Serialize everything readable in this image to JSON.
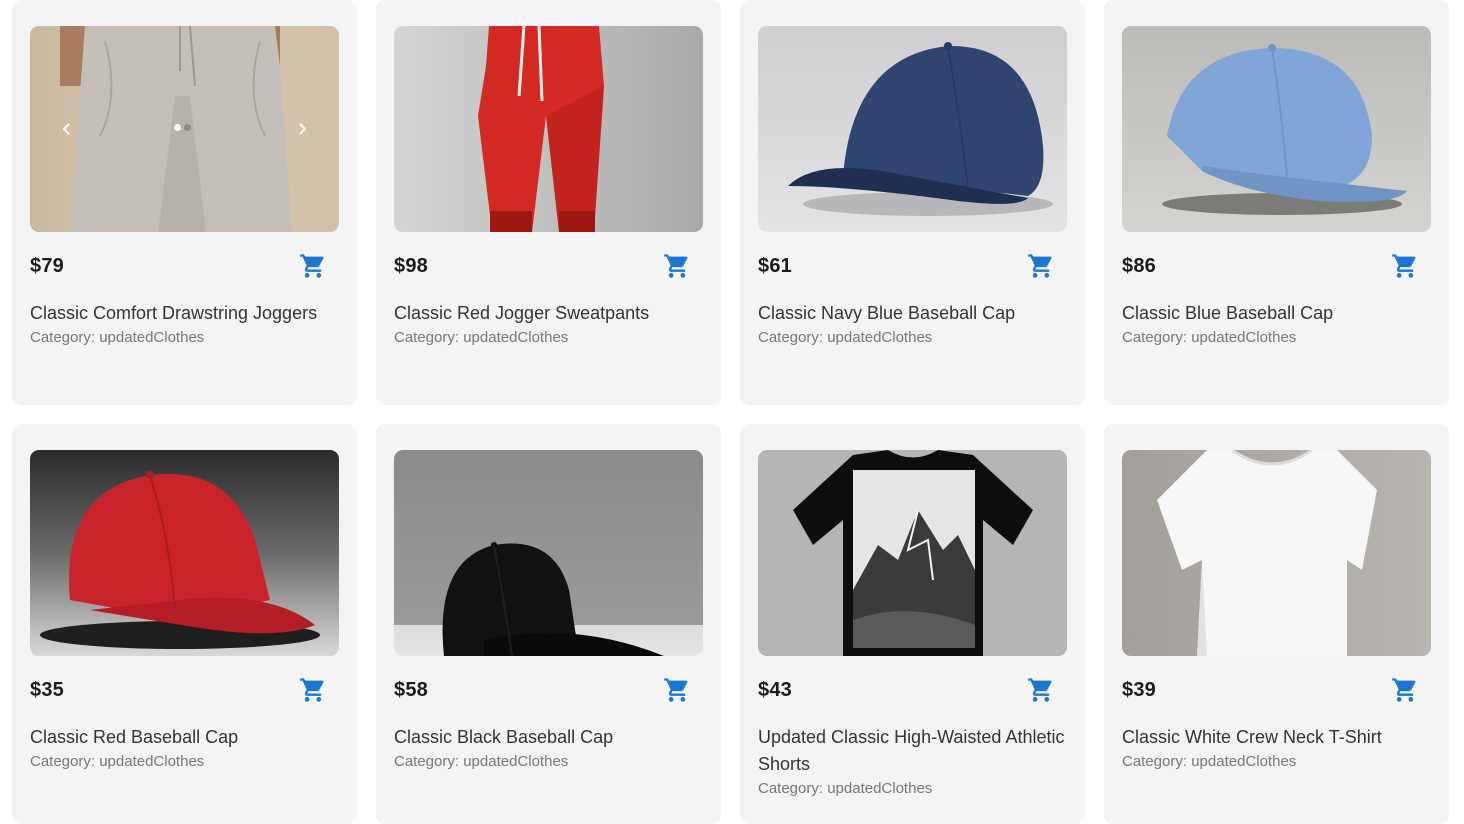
{
  "colors": {
    "accent": "#1976d2",
    "card_bg": "#f4f4f4"
  },
  "products": [
    {
      "price": "$79",
      "title": "Classic Comfort Drawstring Joggers",
      "category": "Category: updatedClothes",
      "image": "grey-joggers",
      "cart_icon": "cart-icon"
    },
    {
      "price": "$98",
      "title": "Classic Red Jogger Sweatpants",
      "category": "Category: updatedClothes",
      "image": "red-joggers",
      "cart_icon": "cart-icon"
    },
    {
      "price": "$61",
      "title": "Classic Navy Blue Baseball Cap",
      "category": "Category: updatedClothes",
      "image": "navy-cap",
      "cart_icon": "cart-icon"
    },
    {
      "price": "$86",
      "title": "Classic Blue Baseball Cap",
      "category": "Category: updatedClothes",
      "image": "blue-cap",
      "cart_icon": "cart-icon"
    },
    {
      "price": "$35",
      "title": "Classic Red Baseball Cap",
      "category": "Category: updatedClothes",
      "image": "red-cap",
      "cart_icon": "cart-icon"
    },
    {
      "price": "$58",
      "title": "Classic Black Baseball Cap",
      "category": "Category: updatedClothes",
      "image": "black-cap",
      "cart_icon": "cart-icon"
    },
    {
      "price": "$43",
      "title": "Updated Classic High-Waisted Athletic Shorts",
      "category": "Category: updatedClothes",
      "image": "black-tshirt-mountain",
      "cart_icon": "cart-icon"
    },
    {
      "price": "$39",
      "title": "Classic White Crew Neck T-Shirt",
      "category": "Category: updatedClothes",
      "image": "white-tshirt",
      "cart_icon": "cart-icon"
    }
  ],
  "carousel": {
    "prev_icon": "chevron-left-icon",
    "next_icon": "chevron-right-icon",
    "active_slide": 1,
    "slide_count": 2
  }
}
